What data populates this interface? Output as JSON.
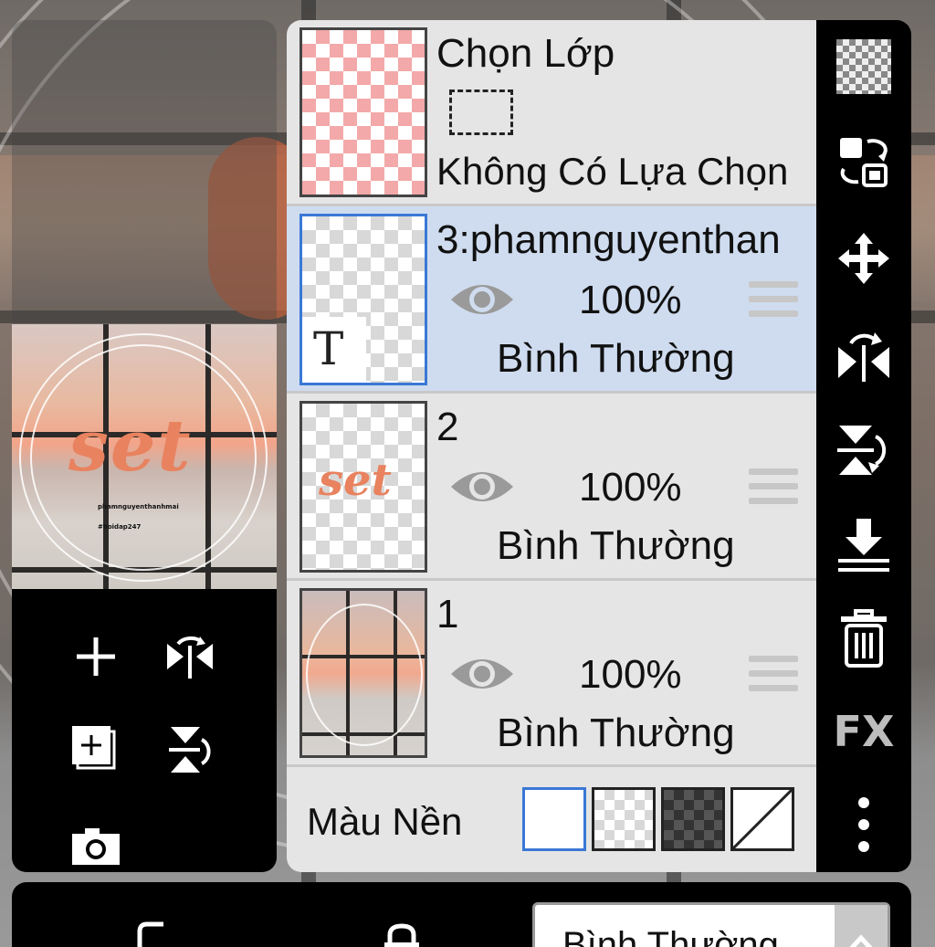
{
  "layers_panel": {
    "selection_layer": {
      "title": "Chọn Lớp",
      "status": "Không Có Lựa Chọn"
    },
    "layers": [
      {
        "name": "3:phamnguyenthan",
        "opacity": "100%",
        "blend": "Bình Thường",
        "selected": true,
        "thumb_glyph": "T"
      },
      {
        "name": "2",
        "opacity": "100%",
        "blend": "Bình Thường",
        "selected": false,
        "thumb_text": "set"
      },
      {
        "name": "1",
        "opacity": "100%",
        "blend": "Bình Thường",
        "selected": false
      }
    ],
    "background_label": "Màu Nền"
  },
  "preview": {
    "art_text": "set",
    "caption_name": "phamnguyenthanhmai",
    "caption_tag": "#hoidap247"
  },
  "right_toolbar": {
    "fx_label": "FX",
    "icons": [
      "checker-icon",
      "swap-icon",
      "move-icon",
      "flip-horizontal-icon",
      "flip-vertical-icon",
      "merge-down-icon",
      "trash-icon",
      "fx-icon",
      "more-icon"
    ]
  },
  "bottom_bar": {
    "blend_mode": "Bình Thường"
  },
  "colors": {
    "accent": "#3a78d6",
    "selected_row": "#cfdcef",
    "panel_bg": "#e5e5e5"
  }
}
